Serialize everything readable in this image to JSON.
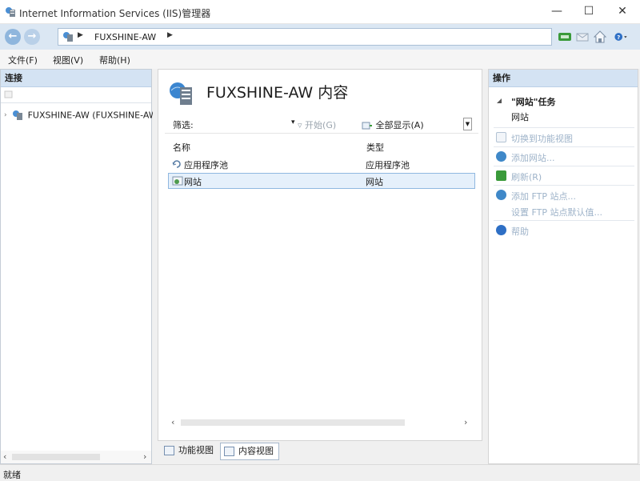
{
  "window": {
    "title": "Internet Information Services (IIS)管理器",
    "minimize": "—",
    "maximize": "☐",
    "close": "✕"
  },
  "address": {
    "server": "FUXSHINE-AW"
  },
  "menu": [
    "文件(F)",
    "视图(V)",
    "帮助(H)"
  ],
  "connections": {
    "header": "连接",
    "node_label": "FUXSHINE-AW (FUXSHINE-AW\\Administrator)"
  },
  "content": {
    "title": "FUXSHINE-AW 内容",
    "filter_label": "筛选:",
    "start_label": "开始(G)",
    "show_all_label": "全部显示(A)",
    "columns": {
      "name": "名称",
      "type": "类型"
    },
    "rows": [
      {
        "name": "应用程序池",
        "type": "应用程序池",
        "icon": "app-pool-icon"
      },
      {
        "name": "网站",
        "type": "网站",
        "icon": "site-icon"
      }
    ],
    "tabs": {
      "features": "功能视图",
      "content": "内容视图"
    }
  },
  "actions": {
    "header": "操作",
    "group_title": "\"网站\"任务",
    "group_sub": "网站",
    "items": [
      {
        "label": "切换到功能视图",
        "icon": "switch-view-icon"
      },
      {
        "label": "添加网站...",
        "icon": "add-site-icon"
      },
      {
        "label": "刷新(R)",
        "icon": "refresh-icon"
      },
      {
        "label": "添加 FTP 站点...",
        "icon": "add-ftp-icon"
      },
      {
        "label": "设置 FTP 站点默认值...",
        "icon": "ftp-defaults-icon"
      },
      {
        "label": "帮助",
        "icon": "help-icon"
      }
    ]
  },
  "status": {
    "text": "就绪"
  },
  "colors": {
    "panel_header": "#d4e3f3",
    "selection": "#e5f0fb",
    "disabled_link": "#9eb3c9"
  }
}
